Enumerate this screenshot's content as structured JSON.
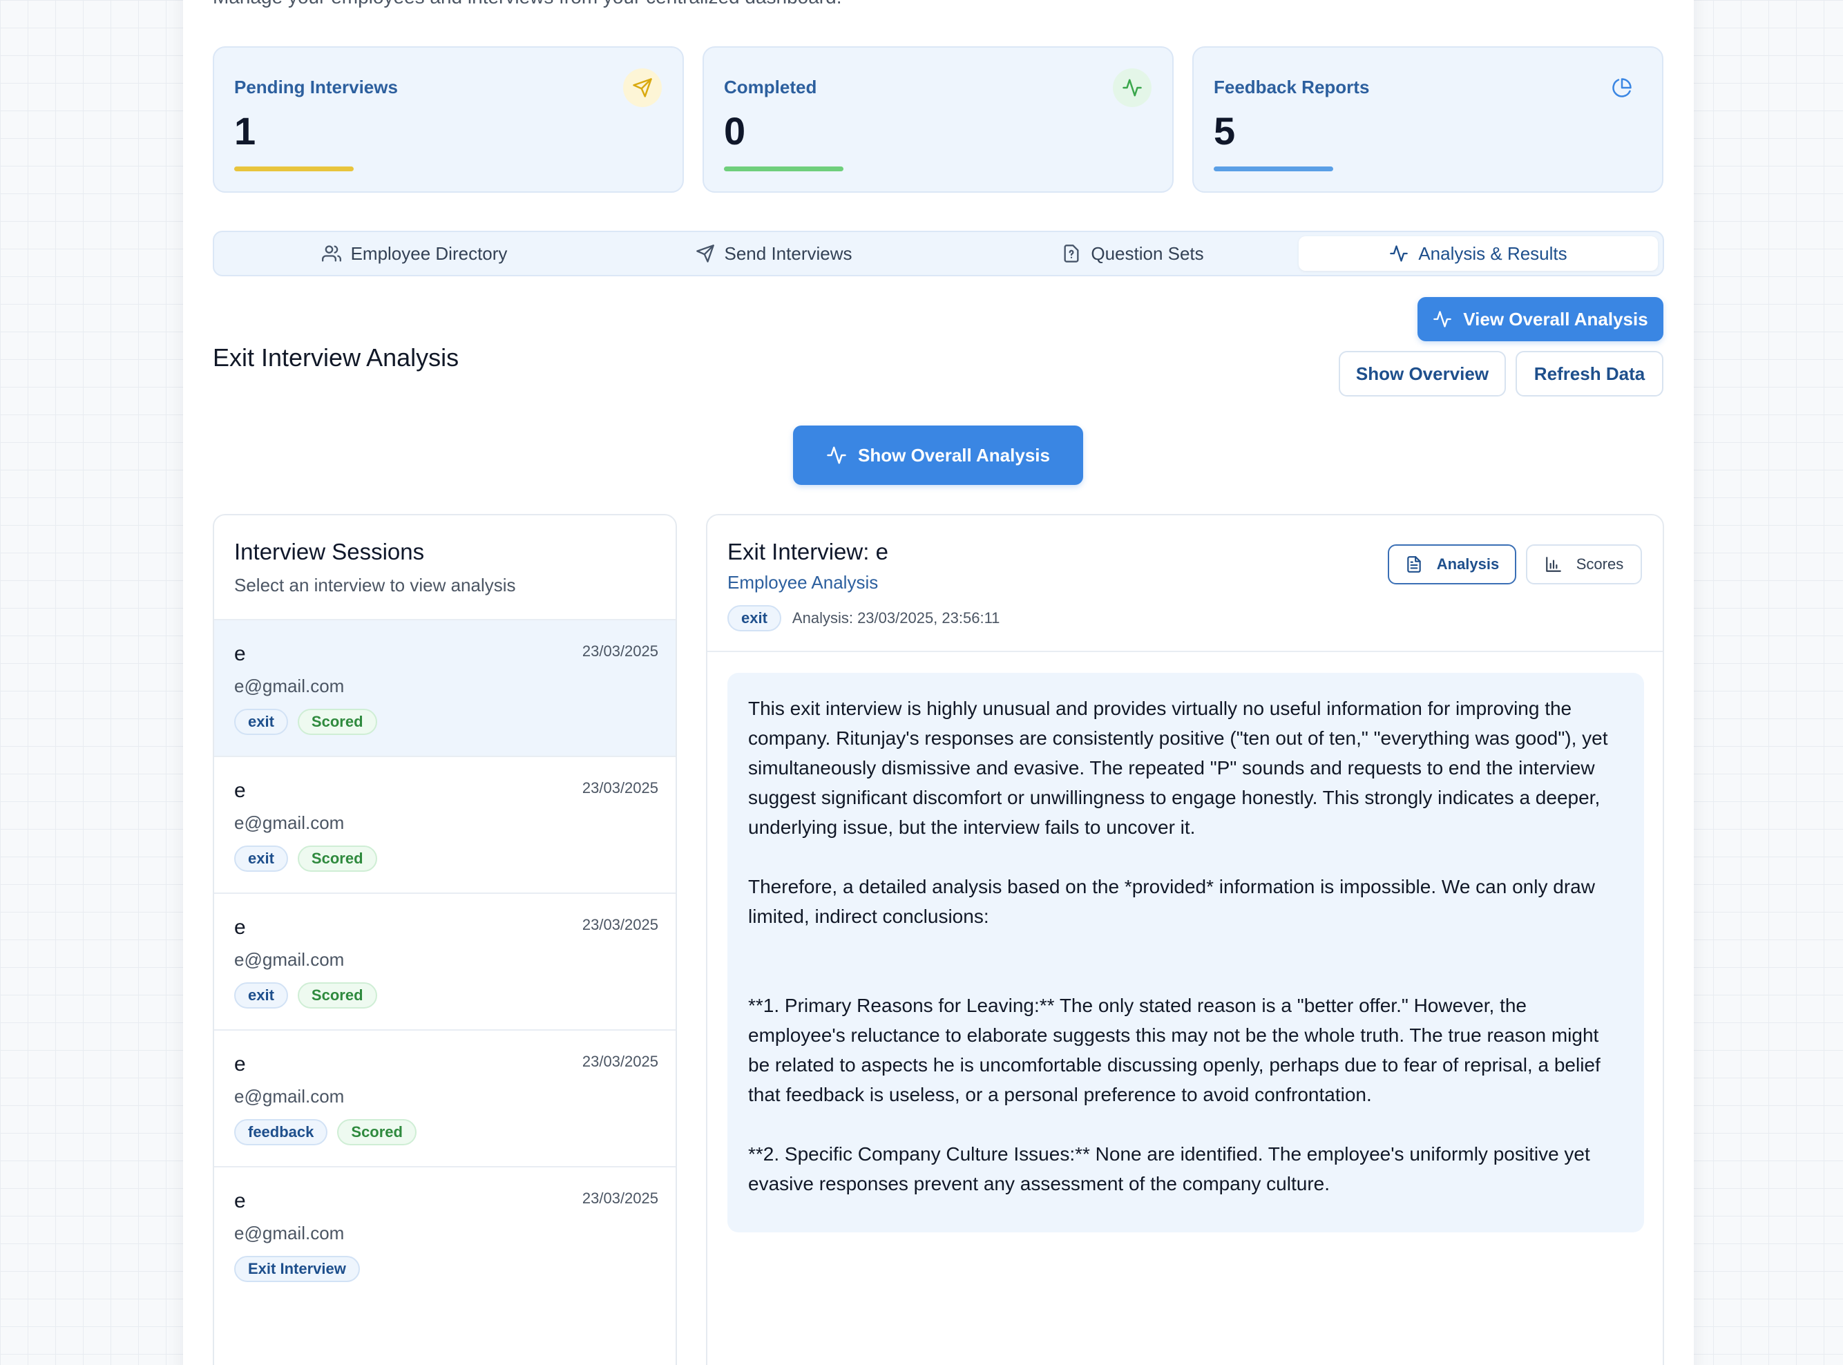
{
  "header": {
    "subtitle": "Manage your employees and interviews from your centralized dashboard."
  },
  "stats": [
    {
      "label": "Pending Interviews",
      "value": "1",
      "icon": "send-icon",
      "color": "#e8c43d"
    },
    {
      "label": "Completed",
      "value": "0",
      "icon": "activity-icon",
      "color": "#6fcf7c"
    },
    {
      "label": "Feedback Reports",
      "value": "5",
      "icon": "pie-chart-icon",
      "color": "#5a9fe6"
    }
  ],
  "tabs": [
    {
      "label": "Employee Directory",
      "icon": "users-icon"
    },
    {
      "label": "Send Interviews",
      "icon": "send-icon"
    },
    {
      "label": "Question Sets",
      "icon": "file-question-icon"
    },
    {
      "label": "Analysis & Results",
      "icon": "activity-icon",
      "active": true
    }
  ],
  "actions": {
    "view_overall": "View Overall Analysis",
    "show_overview": "Show Overview",
    "refresh": "Refresh Data",
    "show_overall": "Show Overall Analysis"
  },
  "section_title": "Exit Interview Analysis",
  "sessions": {
    "title": "Interview Sessions",
    "subtitle": "Select an interview to view analysis",
    "items": [
      {
        "name": "e",
        "email": "e@gmail.com",
        "date": "23/03/2025",
        "type": "exit",
        "status": "Scored"
      },
      {
        "name": "e",
        "email": "e@gmail.com",
        "date": "23/03/2025",
        "type": "exit",
        "status": "Scored"
      },
      {
        "name": "e",
        "email": "e@gmail.com",
        "date": "23/03/2025",
        "type": "exit",
        "status": "Scored"
      },
      {
        "name": "e",
        "email": "e@gmail.com",
        "date": "23/03/2025",
        "type": "feedback",
        "status": "Scored"
      },
      {
        "name": "e",
        "email": "e@gmail.com",
        "date": "23/03/2025",
        "type": "Exit Interview",
        "status": ""
      }
    ]
  },
  "detail": {
    "title": "Exit Interview: e",
    "subtitle": "Employee Analysis",
    "type_badge": "exit",
    "analysis_time": "Analysis: 23/03/2025, 23:56:11",
    "toggle_analysis": "Analysis",
    "toggle_scores": "Scores",
    "paragraphs": [
      "This exit interview is highly unusual and provides virtually no useful information for improving the company. Ritunjay's responses are consistently positive (\"ten out of ten,\" \"everything was good\"), yet simultaneously dismissive and evasive. The repeated \"P\" sounds and requests to end the interview suggest significant discomfort or unwillingness to engage honestly. This strongly indicates a deeper, underlying issue, but the interview fails to uncover it.",
      "Therefore, a detailed analysis based on the *provided* information is impossible. We can only draw limited, indirect conclusions:",
      "**1. Primary Reasons for Leaving:** The only stated reason is a \"better offer.\" However, the employee's reluctance to elaborate suggests this may not be the whole truth. The true reason might be related to aspects he is uncomfortable discussing openly, perhaps due to fear of reprisal, a belief that feedback is useless, or a personal preference to avoid confrontation.",
      "**2. Specific Company Culture Issues:** None are identified. The employee's uniformly positive yet evasive responses prevent any assessment of the company culture."
    ]
  }
}
